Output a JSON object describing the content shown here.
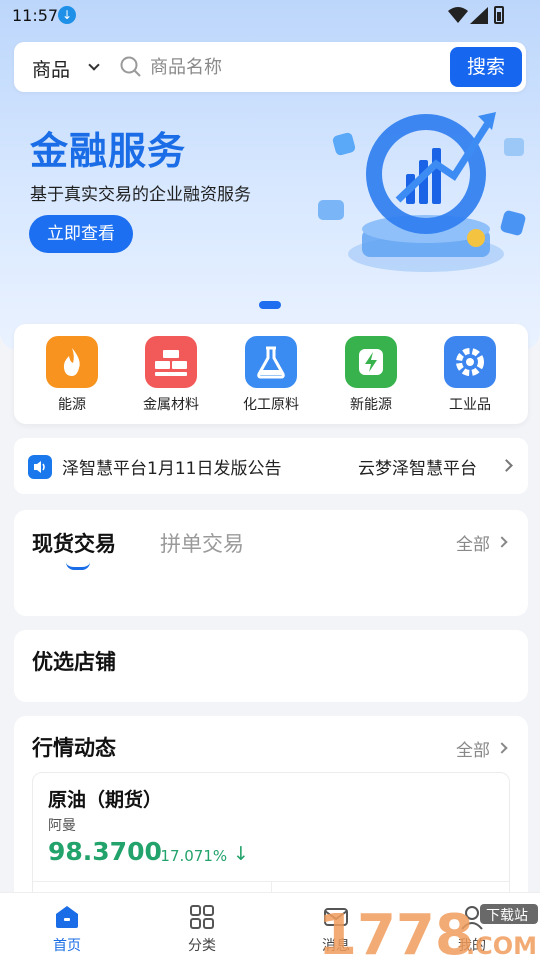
{
  "status_bar": {
    "time": "11:57"
  },
  "search": {
    "category": "商品",
    "placeholder": "商品名称",
    "button": "搜索"
  },
  "banner": {
    "title": "金融服务",
    "subtitle": "基于真实交易的企业融资服务",
    "cta": "立即查看"
  },
  "categories": [
    {
      "label": "能源",
      "color": "#f7931e",
      "icon": "flame-icon"
    },
    {
      "label": "金属材料",
      "color": "#f25a5a",
      "icon": "metal-ingot-icon"
    },
    {
      "label": "化工原料",
      "color": "#3b8cf2",
      "icon": "flask-icon"
    },
    {
      "label": "新能源",
      "color": "#37b24d",
      "icon": "lightning-icon"
    },
    {
      "label": "工业品",
      "color": "#3d86f0",
      "icon": "gear-icon"
    }
  ],
  "notice": {
    "text1": "泽智慧平台1月11日发版公告",
    "text2": "云梦泽智慧平台"
  },
  "trade": {
    "tab_active": "现货交易",
    "tab_inactive": "拼单交易",
    "all": "全部"
  },
  "store": {
    "title": "优选店铺"
  },
  "market": {
    "title": "行情动态",
    "all": "全部",
    "quote": {
      "name": "原油（期货）",
      "location": "阿曼",
      "price": "98.3700",
      "change": "-17.071%"
    }
  },
  "nav": [
    {
      "label": "首页",
      "active": true
    },
    {
      "label": "分类"
    },
    {
      "label": "消息"
    },
    {
      "label": "我的"
    }
  ],
  "colors": {
    "primary": "#1666f0",
    "down_green": "#22a36b"
  },
  "watermark": {
    "text": "1778",
    "sub": "下载站",
    "domain": ".COM"
  }
}
